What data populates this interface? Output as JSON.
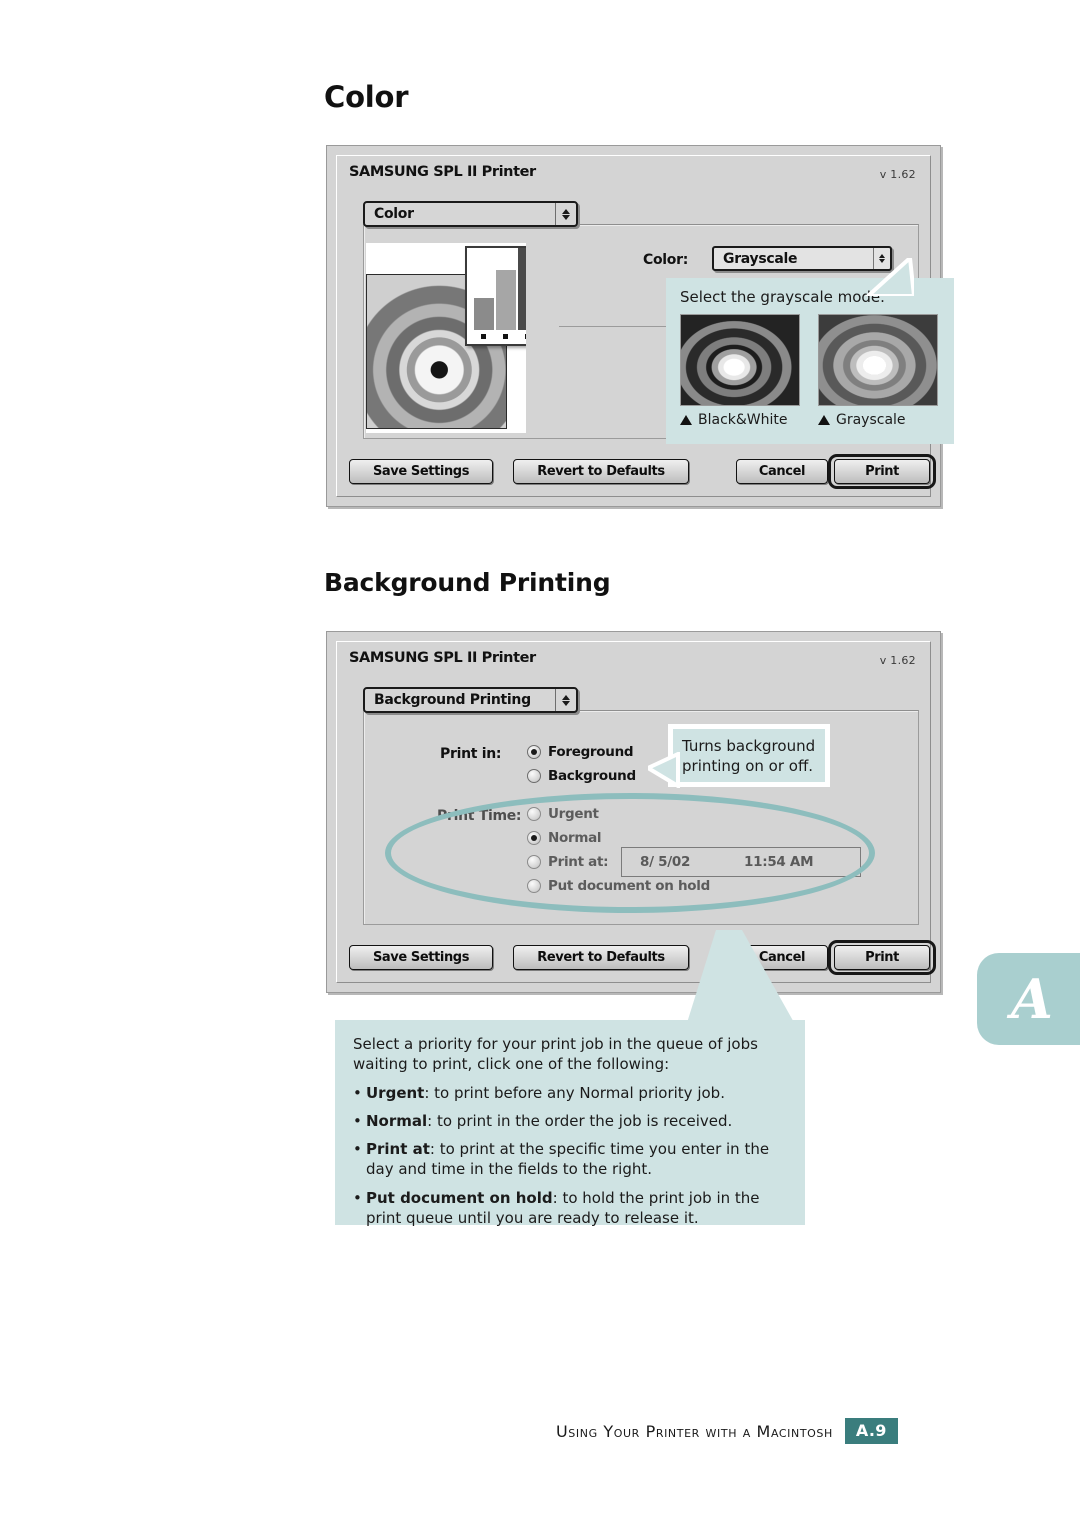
{
  "page": {
    "heading_color": "Color",
    "heading_background_printing": "Background Printing"
  },
  "color_dialog": {
    "title": "SAMSUNG SPL II Printer",
    "version": "v 1.62",
    "panel_menu": {
      "value": "Color",
      "icon": "updown-arrows-icon"
    },
    "color_field": {
      "label": "Color:",
      "value": "Grayscale"
    },
    "buttons": {
      "save_settings": "Save Settings",
      "revert_to_defaults": "Revert to Defaults",
      "cancel": "Cancel",
      "print": "Print"
    },
    "callout": {
      "text": "Select the grayscale mode.",
      "thumbnails": [
        {
          "caption": "Black&White",
          "marker": "up-triangle-icon"
        },
        {
          "caption": "Grayscale",
          "marker": "up-triangle-icon"
        }
      ]
    }
  },
  "background_dialog": {
    "title": "SAMSUNG SPL II Printer",
    "version": "v 1.62",
    "panel_menu": {
      "value": "Background Printing",
      "icon": "updown-arrows-icon"
    },
    "print_in": {
      "label": "Print in:",
      "options": [
        {
          "label": "Foreground",
          "selected": true
        },
        {
          "label": "Background",
          "selected": false
        }
      ]
    },
    "print_time": {
      "label": "Print Time:",
      "options": [
        {
          "label": "Urgent",
          "selected": false
        },
        {
          "label": "Normal",
          "selected": true
        },
        {
          "label": "Print at:",
          "selected": false
        },
        {
          "label": "Put document on hold",
          "selected": false
        }
      ],
      "date_value": "8/ 5/02",
      "time_value": "11:54 AM"
    },
    "buttons": {
      "save_settings": "Save Settings",
      "revert_to_defaults": "Revert to Defaults",
      "cancel": "Cancel",
      "print": "Print"
    },
    "callout_top": "Turns background\nprinting on or off.",
    "callout_bottom": {
      "intro_line1": "Select a priority for your print job in the queue of jobs",
      "intro_line2": "waiting to print, click one of the following:",
      "items": [
        {
          "term": "Urgent",
          "desc": ": to print before any Normal priority job."
        },
        {
          "term": "Normal",
          "desc": ": to print in the order the job is received."
        },
        {
          "term": "Print at",
          "desc": ": to print at the specific time you enter in the day and time in the fields to the right."
        },
        {
          "term": "Put document on hold",
          "desc": ": to hold the print job in the print queue until you are ready to release it."
        }
      ]
    }
  },
  "appendix": {
    "letter": "A"
  },
  "footer": {
    "text": "Using Your Printer with a Macintosh",
    "page": "A.9"
  },
  "colors": {
    "callout_bg": "#cfe3e3",
    "oval": "#8dbdbd",
    "tab_bg": "#a9cfcf",
    "page_badge": "#3a7d7d",
    "dialog_bg": "#d4d4d4"
  }
}
